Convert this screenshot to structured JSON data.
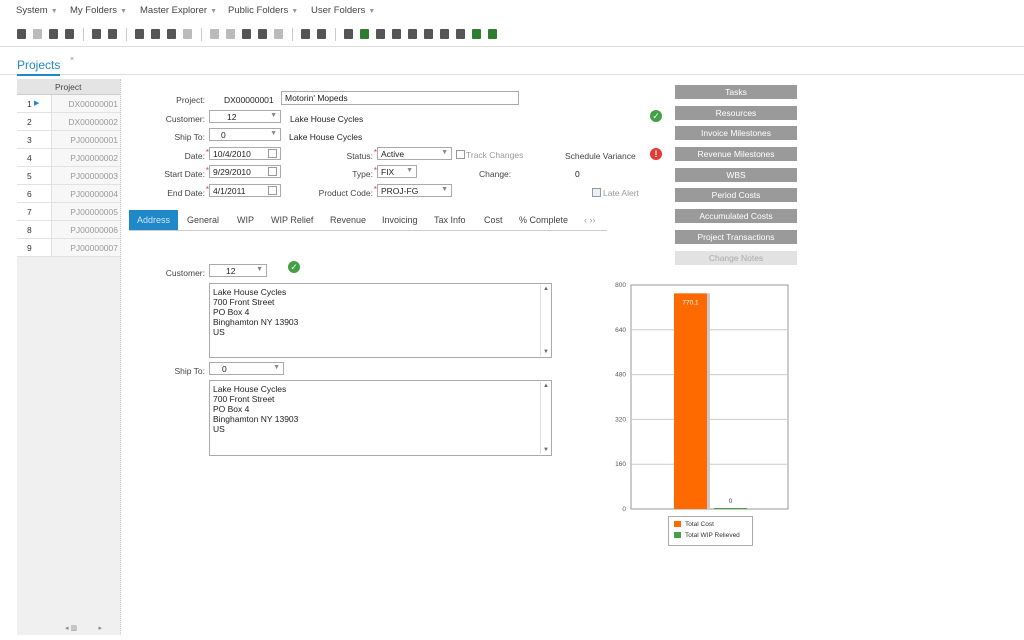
{
  "menu": [
    "System",
    "My Folders",
    "Master Explorer",
    "Public Folders",
    "User Folders"
  ],
  "main_tab": {
    "label": "Projects",
    "close": "×"
  },
  "grid": {
    "header": "Project",
    "rows": [
      {
        "num": "1",
        "id": "DX00000001",
        "selected": true
      },
      {
        "num": "2",
        "id": "DX00000002"
      },
      {
        "num": "3",
        "id": "PJ00000001"
      },
      {
        "num": "4",
        "id": "PJ00000002"
      },
      {
        "num": "5",
        "id": "PJ00000003"
      },
      {
        "num": "6",
        "id": "PJ00000004"
      },
      {
        "num": "7",
        "id": "PJ00000005"
      },
      {
        "num": "8",
        "id": "PJ00000006"
      },
      {
        "num": "9",
        "id": "PJ00000007"
      }
    ]
  },
  "form": {
    "project_label": "Project:",
    "project_id": "DX00000001",
    "project_name": "Motorin' Mopeds",
    "customer_label": "Customer:",
    "customer_value": "12",
    "customer_name": "Lake House Cycles",
    "shipto_label": "Ship To:",
    "shipto_value": "0",
    "shipto_name": "Lake House Cycles",
    "date_label": "Date:",
    "date_value": "10/4/2010",
    "start_label": "Start Date:",
    "start_value": "9/29/2010",
    "end_label": "End Date:",
    "end_value": "4/1/2011",
    "status_label": "Status:",
    "status_value": "Active",
    "type_label": "Type:",
    "type_value": "FIX",
    "product_label": "Product Code:",
    "product_value": "PROJ-FG",
    "track_changes": "Track Changes",
    "schedule_variance": "Schedule Variance",
    "change_label": "Change:",
    "change_value": "0",
    "late_alert": "Late Alert"
  },
  "subtabs": [
    "Address",
    "General",
    "WIP",
    "WIP Relief",
    "Revenue",
    "Invoicing",
    "Tax Info",
    "Cost",
    "% Complete",
    "‹ ››"
  ],
  "address": {
    "customer_label": "Customer:",
    "customer_value": "12",
    "customer_lines": [
      "Lake House Cycles",
      "700 Front Street",
      "PO Box 4",
      "Binghamton NY 13903",
      "US"
    ],
    "shipto_label": "Ship To:",
    "shipto_value": "0",
    "shipto_lines": [
      "Lake House Cycles",
      "700 Front Street",
      "PO Box 4",
      "Binghamton NY 13903",
      "US"
    ]
  },
  "side_buttons": [
    {
      "label": "Tasks"
    },
    {
      "label": "Resources"
    },
    {
      "label": "Invoice Milestones"
    },
    {
      "label": "Revenue Milestones"
    },
    {
      "label": "WBS"
    },
    {
      "label": "Period Costs"
    },
    {
      "label": "Accumulated Costs"
    },
    {
      "label": "Project Transactions"
    },
    {
      "label": "Change Notes",
      "disabled": true
    }
  ],
  "colors": {
    "accent": "#1e88c8",
    "total_cost": "#ff6a00",
    "wip_relieved": "#43a047"
  },
  "chart_data": {
    "type": "bar",
    "categories": [
      "Total Cost",
      "Total WIP Relieved"
    ],
    "values": [
      770.1,
      0
    ],
    "data_labels": [
      "770.1",
      "0"
    ],
    "ylim": [
      0,
      800
    ],
    "yticks": [
      "800",
      "640",
      "480",
      "320",
      "160",
      "0"
    ],
    "legend": [
      "Total Cost",
      "Total WIP Relieved"
    ],
    "legend_position": "bottom",
    "grid": true
  }
}
